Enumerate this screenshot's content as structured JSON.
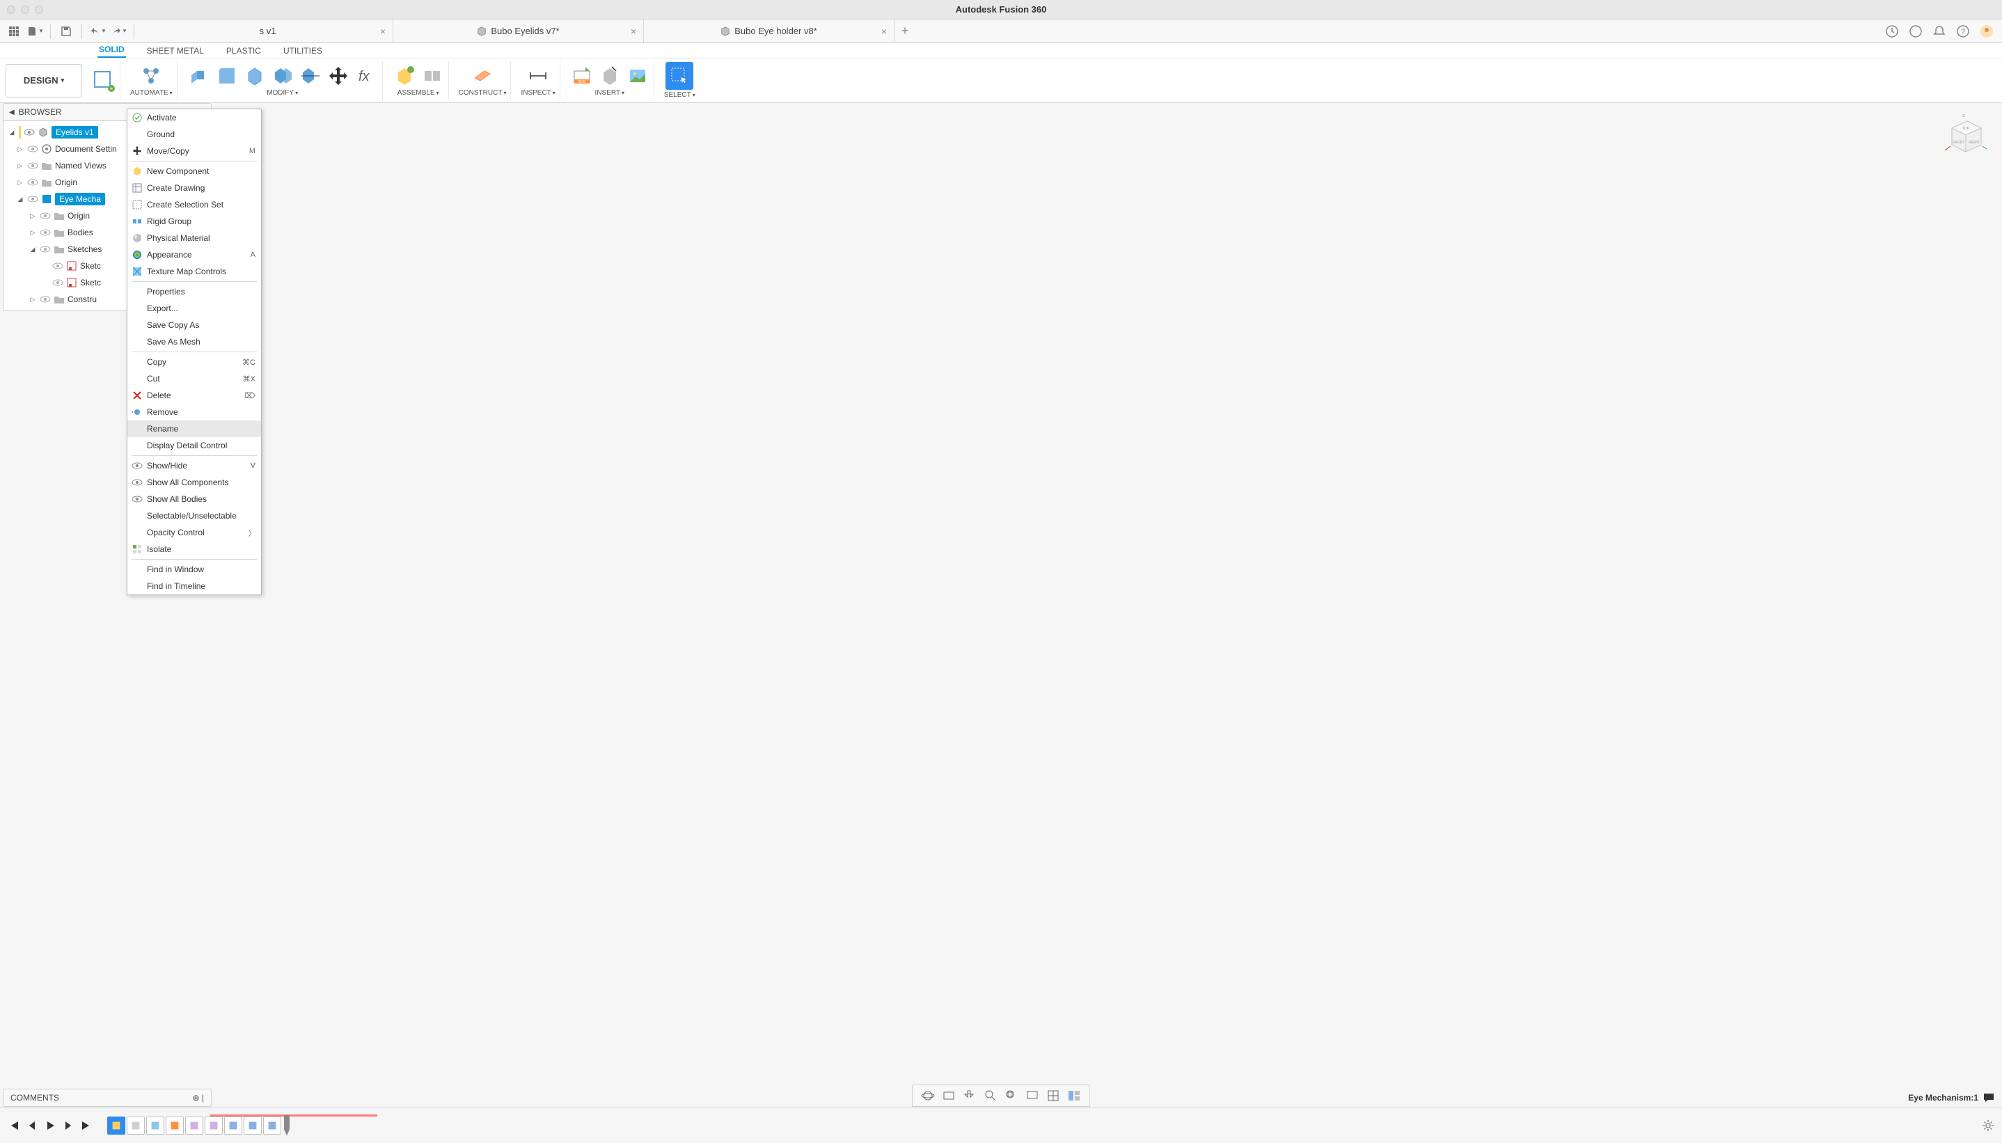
{
  "app_title": "Autodesk Fusion 360",
  "tabs": [
    {
      "label": "s v1",
      "modified": false
    },
    {
      "label": "Bubo Eyelids v7*",
      "modified": true
    },
    {
      "label": "Bubo Eye holder v8*",
      "modified": true
    }
  ],
  "workspace_tabs": [
    "SOLID",
    "SHEET METAL",
    "PLASTIC",
    "UTILITIES"
  ],
  "active_ws_tab": "SOLID",
  "design_button": "DESIGN",
  "ribbon_groups": {
    "automate": "AUTOMATE",
    "modify": "MODIFY",
    "assemble": "ASSEMBLE",
    "construct": "CONSTRUCT",
    "inspect": "INSPECT",
    "insert": "INSERT",
    "select": "SELECT"
  },
  "browser": {
    "title": "BROWSER",
    "root": "Eyelids v1",
    "items": [
      {
        "label": "Document Settin",
        "level": 1,
        "exp": "▷"
      },
      {
        "label": "Named Views",
        "level": 1,
        "exp": "▷"
      },
      {
        "label": "Origin",
        "level": 1,
        "exp": "▷"
      },
      {
        "label": "Eye Mecha",
        "level": 1,
        "exp": "◢",
        "selected": true
      },
      {
        "label": "Origin",
        "level": 2,
        "exp": "▷"
      },
      {
        "label": "Bodies",
        "level": 2,
        "exp": "▷"
      },
      {
        "label": "Sketches",
        "level": 2,
        "exp": "◢"
      },
      {
        "label": "Sketc",
        "level": 3,
        "exp": ""
      },
      {
        "label": "Sketc",
        "level": 3,
        "exp": ""
      },
      {
        "label": "Constru",
        "level": 2,
        "exp": "▷"
      }
    ]
  },
  "context_menu": [
    {
      "type": "item",
      "label": "Activate",
      "icon": "check"
    },
    {
      "type": "item",
      "label": "Ground"
    },
    {
      "type": "item",
      "label": "Move/Copy",
      "icon": "move",
      "shortcut": "M"
    },
    {
      "type": "sep"
    },
    {
      "type": "item",
      "label": "New Component",
      "icon": "component"
    },
    {
      "type": "item",
      "label": "Create Drawing",
      "icon": "drawing"
    },
    {
      "type": "item",
      "label": "Create Selection Set",
      "icon": "selset"
    },
    {
      "type": "item",
      "label": "Rigid Group",
      "icon": "rigid"
    },
    {
      "type": "item",
      "label": "Physical Material",
      "icon": "material"
    },
    {
      "type": "item",
      "label": "Appearance",
      "icon": "appearance",
      "shortcut": "A"
    },
    {
      "type": "item",
      "label": "Texture Map Controls",
      "icon": "texture"
    },
    {
      "type": "sep"
    },
    {
      "type": "item",
      "label": "Properties"
    },
    {
      "type": "item",
      "label": "Export..."
    },
    {
      "type": "item",
      "label": "Save Copy As"
    },
    {
      "type": "item",
      "label": "Save As Mesh"
    },
    {
      "type": "sep"
    },
    {
      "type": "item",
      "label": "Copy",
      "shortcut": "⌘C"
    },
    {
      "type": "item",
      "label": "Cut",
      "shortcut": "⌘X"
    },
    {
      "type": "item",
      "label": "Delete",
      "icon": "delete",
      "shortcut": "⌦"
    },
    {
      "type": "item",
      "label": "Remove",
      "icon": "remove"
    },
    {
      "type": "item",
      "label": "Rename",
      "hover": true
    },
    {
      "type": "item",
      "label": "Display Detail Control"
    },
    {
      "type": "sep"
    },
    {
      "type": "item",
      "label": "Show/Hide",
      "icon": "eye",
      "shortcut": "V"
    },
    {
      "type": "item",
      "label": "Show All Components",
      "icon": "eye"
    },
    {
      "type": "item",
      "label": "Show All Bodies",
      "icon": "eye"
    },
    {
      "type": "item",
      "label": "Selectable/Unselectable"
    },
    {
      "type": "item",
      "label": "Opacity Control",
      "submenu": true
    },
    {
      "type": "item",
      "label": "Isolate",
      "icon": "isolate"
    },
    {
      "type": "sep"
    },
    {
      "type": "item",
      "label": "Find in Window"
    },
    {
      "type": "item",
      "label": "Find in Timeline"
    }
  ],
  "comments_label": "COMMENTS",
  "status_text": "Eye Mechanism:1",
  "viewcube": {
    "top": "TOP",
    "front": "FRONT",
    "right": "RIGHT"
  },
  "timeline_count": 9
}
